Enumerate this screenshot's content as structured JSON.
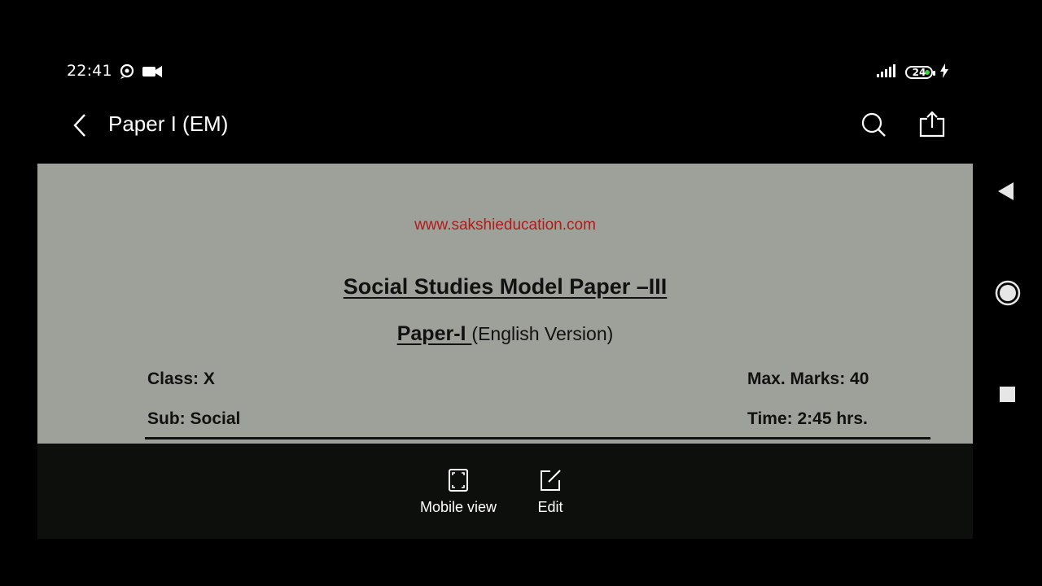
{
  "status_bar": {
    "time": "22:41",
    "left_icons": [
      "chat-notification-icon",
      "video-camera-icon"
    ],
    "right_icons": [
      "signal-icon",
      "battery-icon",
      "charging-bolt-icon"
    ],
    "battery_level": "24",
    "battery_color": "#3ecf3e"
  },
  "app_bar": {
    "title": "Paper I  (EM)",
    "actions": [
      "search-icon",
      "share-icon"
    ]
  },
  "document": {
    "url": "www.sakshieducation.com",
    "title": "Social Studies Model Paper –III",
    "paper_label": "Paper-I ",
    "paper_version": "(English Version)",
    "class_line": "Class: X",
    "subject_line": "Sub: Social",
    "marks_line": "Max. Marks: 40",
    "time_line": "Time: 2:45 hrs.",
    "url_color": "#b21a1a",
    "background_color": "#9ea19a"
  },
  "toolbar": {
    "mobile_view_label": "Mobile view",
    "edit_label": "Edit"
  },
  "system_nav": {
    "buttons": [
      "nav-back-icon",
      "nav-home-icon",
      "nav-recents-icon"
    ]
  }
}
